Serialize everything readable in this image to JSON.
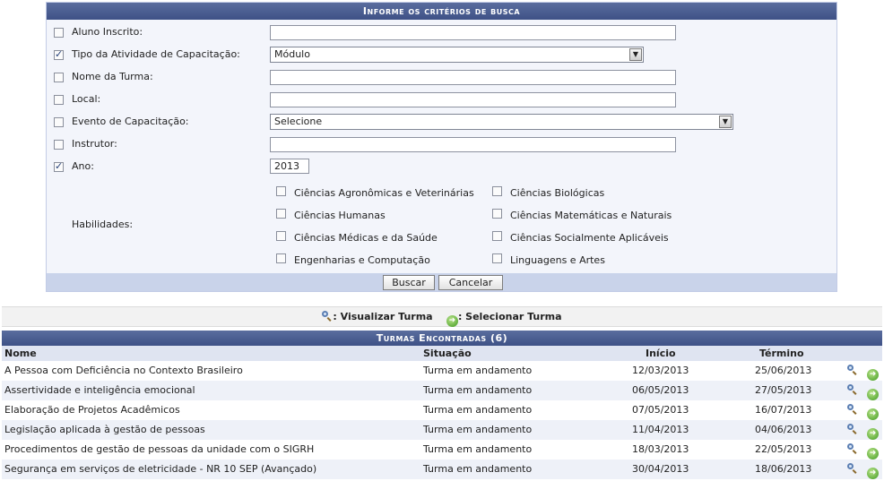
{
  "search": {
    "title": "Informe os critérios de busca",
    "fields": [
      {
        "label": "Aluno Inscrito:",
        "checked": false,
        "type": "text",
        "value": ""
      },
      {
        "label": "Tipo da Atividade de Capacitação:",
        "checked": true,
        "type": "select",
        "value": "Módulo"
      },
      {
        "label": "Nome da Turma:",
        "checked": false,
        "type": "text",
        "value": ""
      },
      {
        "label": "Local:",
        "checked": false,
        "type": "text",
        "value": ""
      },
      {
        "label": "Evento de Capacitação:",
        "checked": false,
        "type": "select",
        "value": "Selecione"
      },
      {
        "label": "Instrutor:",
        "checked": false,
        "type": "text",
        "value": ""
      },
      {
        "label": "Ano:",
        "checked": true,
        "type": "text",
        "value": "2013"
      }
    ],
    "habilidades_label": "Habilidades:",
    "habilidades": [
      "Ciências Agronômicas e Veterinárias",
      "Ciências Biológicas",
      "Ciências Humanas",
      "Ciências Matemáticas e Naturais",
      "Ciências Médicas e da Saúde",
      "Ciências Socialmente Aplicáveis",
      "Engenharias e Computação",
      "Linguagens e Artes"
    ],
    "buscar_label": "Buscar",
    "cancelar_label": "Cancelar"
  },
  "legend": {
    "view_label": ": Visualizar Turma",
    "select_label": ": Selecionar Turma"
  },
  "results": {
    "title": "Turmas Encontradas (6)",
    "columns": {
      "nome": "Nome",
      "situacao": "Situação",
      "inicio": "Início",
      "termino": "Término"
    },
    "rows": [
      {
        "nome": "A Pessoa com Deficiência no Contexto Brasileiro",
        "situacao": "Turma em andamento",
        "inicio": "12/03/2013",
        "termino": "25/06/2013"
      },
      {
        "nome": "Assertividade e inteligência emocional",
        "situacao": "Turma em andamento",
        "inicio": "06/05/2013",
        "termino": "27/05/2013"
      },
      {
        "nome": "Elaboração de Projetos Acadêmicos",
        "situacao": "Turma em andamento",
        "inicio": "07/05/2013",
        "termino": "16/07/2013"
      },
      {
        "nome": "Legislação aplicada à gestão de pessoas",
        "situacao": "Turma em andamento",
        "inicio": "11/04/2013",
        "termino": "04/06/2013"
      },
      {
        "nome": "Procedimentos de gestão de pessoas da unidade com o SIGRH",
        "situacao": "Turma em andamento",
        "inicio": "18/03/2013",
        "termino": "22/05/2013"
      },
      {
        "nome": "Segurança em serviços de eletricidade - NR 10 SEP (Avançado)",
        "situacao": "Turma em andamento",
        "inicio": "30/04/2013",
        "termino": "18/06/2013"
      }
    ]
  }
}
